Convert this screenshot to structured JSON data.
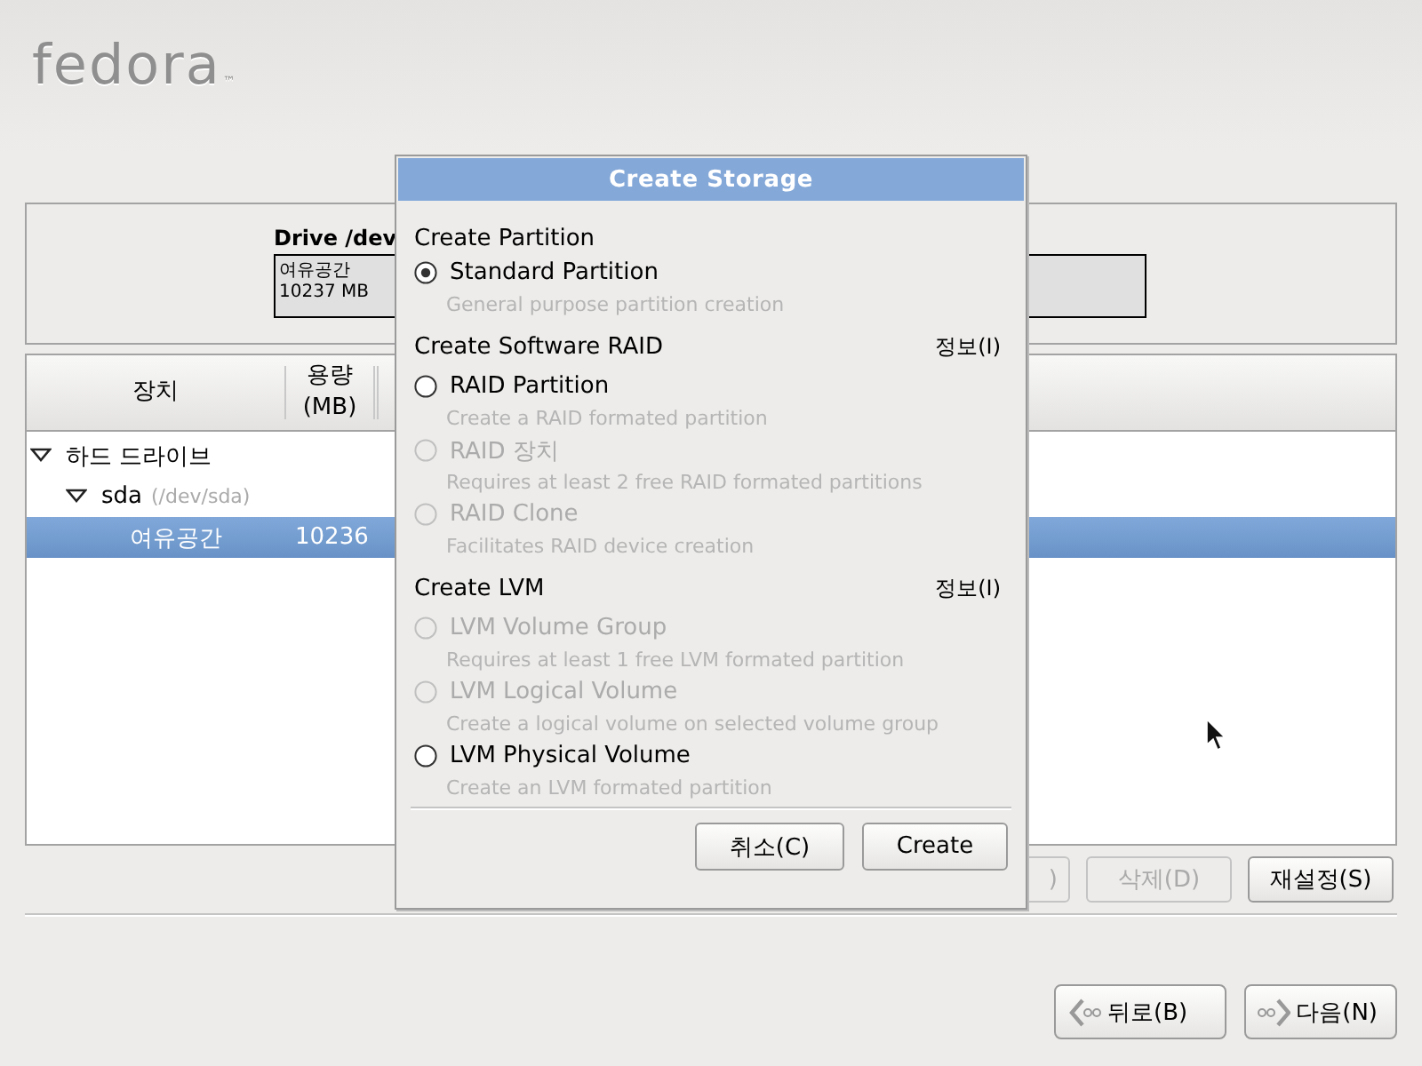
{
  "logo": {
    "text": "fedora",
    "mark": "™"
  },
  "drive_panel": {
    "title": "Drive /dev",
    "segment": {
      "label": "여유공간",
      "size": "10237 MB"
    }
  },
  "tree": {
    "columns": [
      "장치",
      "용량 (MB)"
    ],
    "rows": [
      {
        "name": "하드 드라이브",
        "expanded": true,
        "selected": false,
        "children": [
          {
            "name": "sda",
            "detail": "(/dev/sda)",
            "expanded": true,
            "selected": false,
            "children": [
              {
                "name": "여유공간",
                "size": "10236",
                "selected": true
              }
            ]
          }
        ]
      }
    ]
  },
  "actions": [
    {
      "label": ")",
      "disabled": true
    },
    {
      "label": "삭제(D)",
      "disabled": true
    },
    {
      "label": "재설정(S)",
      "disabled": false
    }
  ],
  "dialog": {
    "title": "Create Storage",
    "sections": [
      {
        "heading": "Create Partition",
        "options": [
          {
            "label": "Standard Partition",
            "description": "General purpose partition creation",
            "selected": true,
            "disabled": false
          }
        ]
      },
      {
        "heading": "Create Software RAID",
        "info": "정보(I)",
        "options": [
          {
            "label": "RAID Partition",
            "description": "Create a RAID formated partition",
            "selected": false,
            "disabled": false
          },
          {
            "label": "RAID 장치",
            "description": "Requires at least 2 free RAID formated partitions",
            "selected": false,
            "disabled": true
          },
          {
            "label": "RAID Clone",
            "description": "Facilitates RAID device creation",
            "selected": false,
            "disabled": true
          }
        ]
      },
      {
        "heading": "Create LVM",
        "info": "정보(I)",
        "options": [
          {
            "label": "LVM Volume Group",
            "description": "Requires at least 1 free LVM formated partition",
            "selected": false,
            "disabled": true
          },
          {
            "label": "LVM Logical Volume",
            "description": "Create a logical volume on selected volume group",
            "selected": false,
            "disabled": true
          },
          {
            "label": "LVM Physical Volume",
            "description": "Create an LVM formated partition",
            "selected": false,
            "disabled": false
          }
        ]
      }
    ],
    "buttons": [
      "취소(C)",
      "Create"
    ]
  },
  "nav": [
    {
      "kind": "back",
      "label": "뒤로(B)"
    },
    {
      "kind": "next",
      "label": "다음(N)"
    }
  ]
}
